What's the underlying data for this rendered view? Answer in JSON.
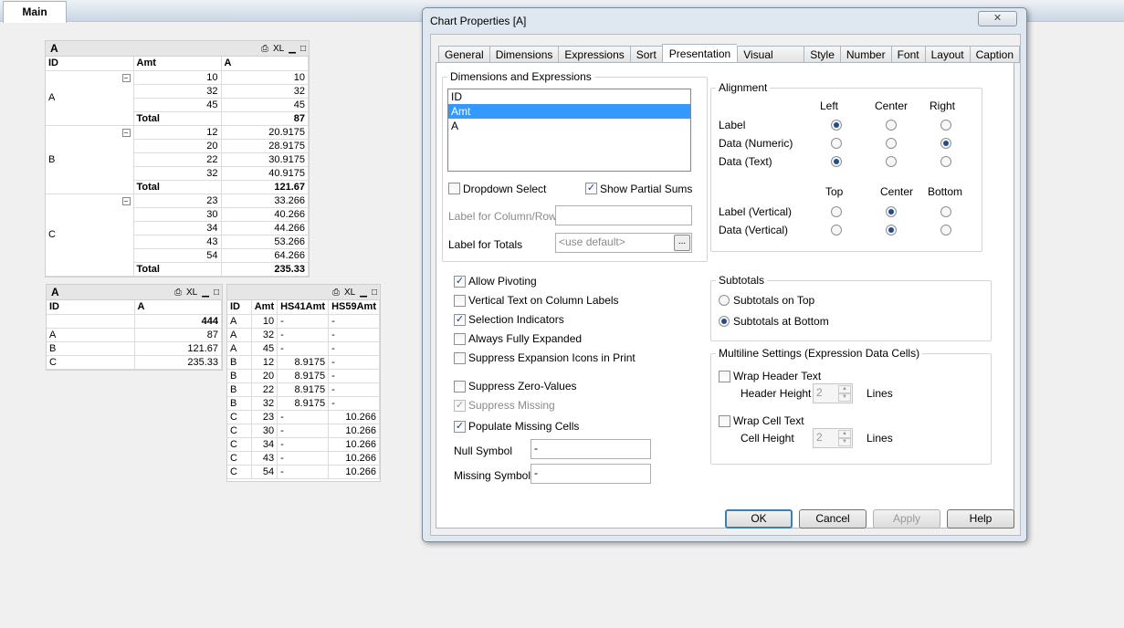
{
  "sheet": {
    "tab": "Main"
  },
  "pivot": {
    "caption": "A",
    "icons": {
      "print": "⎙",
      "xl": "XL",
      "min": "▁",
      "max": "□"
    },
    "headers": [
      "ID",
      "Amt",
      "A"
    ],
    "groups": [
      {
        "id": "A",
        "rows": [
          [
            "10",
            "10"
          ],
          [
            "32",
            "32"
          ],
          [
            "45",
            "45"
          ]
        ],
        "total_label": "Total",
        "total": "87"
      },
      {
        "id": "B",
        "rows": [
          [
            "12",
            "20.9175"
          ],
          [
            "20",
            "28.9175"
          ],
          [
            "22",
            "30.9175"
          ],
          [
            "32",
            "40.9175"
          ]
        ],
        "total_label": "Total",
        "total": "121.67"
      },
      {
        "id": "C",
        "rows": [
          [
            "23",
            "33.266"
          ],
          [
            "30",
            "40.266"
          ],
          [
            "34",
            "44.266"
          ],
          [
            "43",
            "53.266"
          ],
          [
            "54",
            "64.266"
          ]
        ],
        "total_label": "Total",
        "total": "235.33"
      }
    ]
  },
  "straight": {
    "caption": "A",
    "headers": [
      "ID",
      "A"
    ],
    "total": "444",
    "rows": [
      [
        "A",
        "87"
      ],
      [
        "B",
        "121.67"
      ],
      [
        "C",
        "235.33"
      ]
    ]
  },
  "detail": {
    "headers": [
      "ID",
      "Amt",
      "HS41Amt",
      "HS59Amt"
    ],
    "rows": [
      [
        "A",
        "10",
        "-",
        "-"
      ],
      [
        "A",
        "32",
        "-",
        "-"
      ],
      [
        "A",
        "45",
        "-",
        "-"
      ],
      [
        "B",
        "12",
        "8.9175",
        "-"
      ],
      [
        "B",
        "20",
        "8.9175",
        "-"
      ],
      [
        "B",
        "22",
        "8.9175",
        "-"
      ],
      [
        "B",
        "32",
        "8.9175",
        "-"
      ],
      [
        "C",
        "23",
        "-",
        "10.266"
      ],
      [
        "C",
        "30",
        "-",
        "10.266"
      ],
      [
        "C",
        "34",
        "-",
        "10.266"
      ],
      [
        "C",
        "43",
        "-",
        "10.266"
      ],
      [
        "C",
        "54",
        "-",
        "10.266"
      ]
    ]
  },
  "dialog": {
    "title": "Chart Properties [A]",
    "close": "✕",
    "tabs": [
      "General",
      "Dimensions",
      "Expressions",
      "Sort",
      "Presentation",
      "Visual Cues",
      "Style",
      "Number",
      "Font",
      "Layout",
      "Caption"
    ],
    "dim_group": "Dimensions and Expressions",
    "list": [
      "ID",
      "Amt",
      "A"
    ],
    "dropdown_select": "Dropdown Select",
    "show_partial_sums": "Show Partial Sums",
    "label_colrow": "Label for Column/Row",
    "label_totals": "Label for Totals",
    "totals_placeholder": "<use default>",
    "dots": "...",
    "alignment": {
      "title": "Alignment",
      "cols": [
        "Left",
        "Center",
        "Right"
      ],
      "rows": [
        "Label",
        "Data (Numeric)",
        "Data (Text)"
      ],
      "vcols": [
        "Top",
        "Center",
        "Bottom"
      ],
      "vrows": [
        "Label (Vertical)",
        "Data (Vertical)"
      ]
    },
    "options": [
      "Allow Pivoting",
      "Vertical Text on Column Labels",
      "Selection Indicators",
      "Always Fully Expanded",
      "Suppress Expansion Icons in Print"
    ],
    "suppress_zero": "Suppress Zero-Values",
    "suppress_missing": "Suppress Missing",
    "populate_missing": "Populate Missing Cells",
    "null_symbol": "Null Symbol",
    "null_value": "-",
    "missing_symbol": "Missing Symbol",
    "missing_value": "-",
    "subtotals": {
      "title": "Subtotals",
      "top": "Subtotals on Top",
      "bottom": "Subtotals at Bottom"
    },
    "multiline": {
      "title": "Multiline Settings (Expression Data Cells)",
      "wrap_header": "Wrap Header Text",
      "header_height": "Header Height",
      "header_val": "2",
      "lines": "Lines",
      "wrap_cell": "Wrap Cell Text",
      "cell_height": "Cell Height",
      "cell_val": "2"
    },
    "buttons": {
      "ok": "OK",
      "cancel": "Cancel",
      "apply": "Apply",
      "help": "Help"
    }
  }
}
